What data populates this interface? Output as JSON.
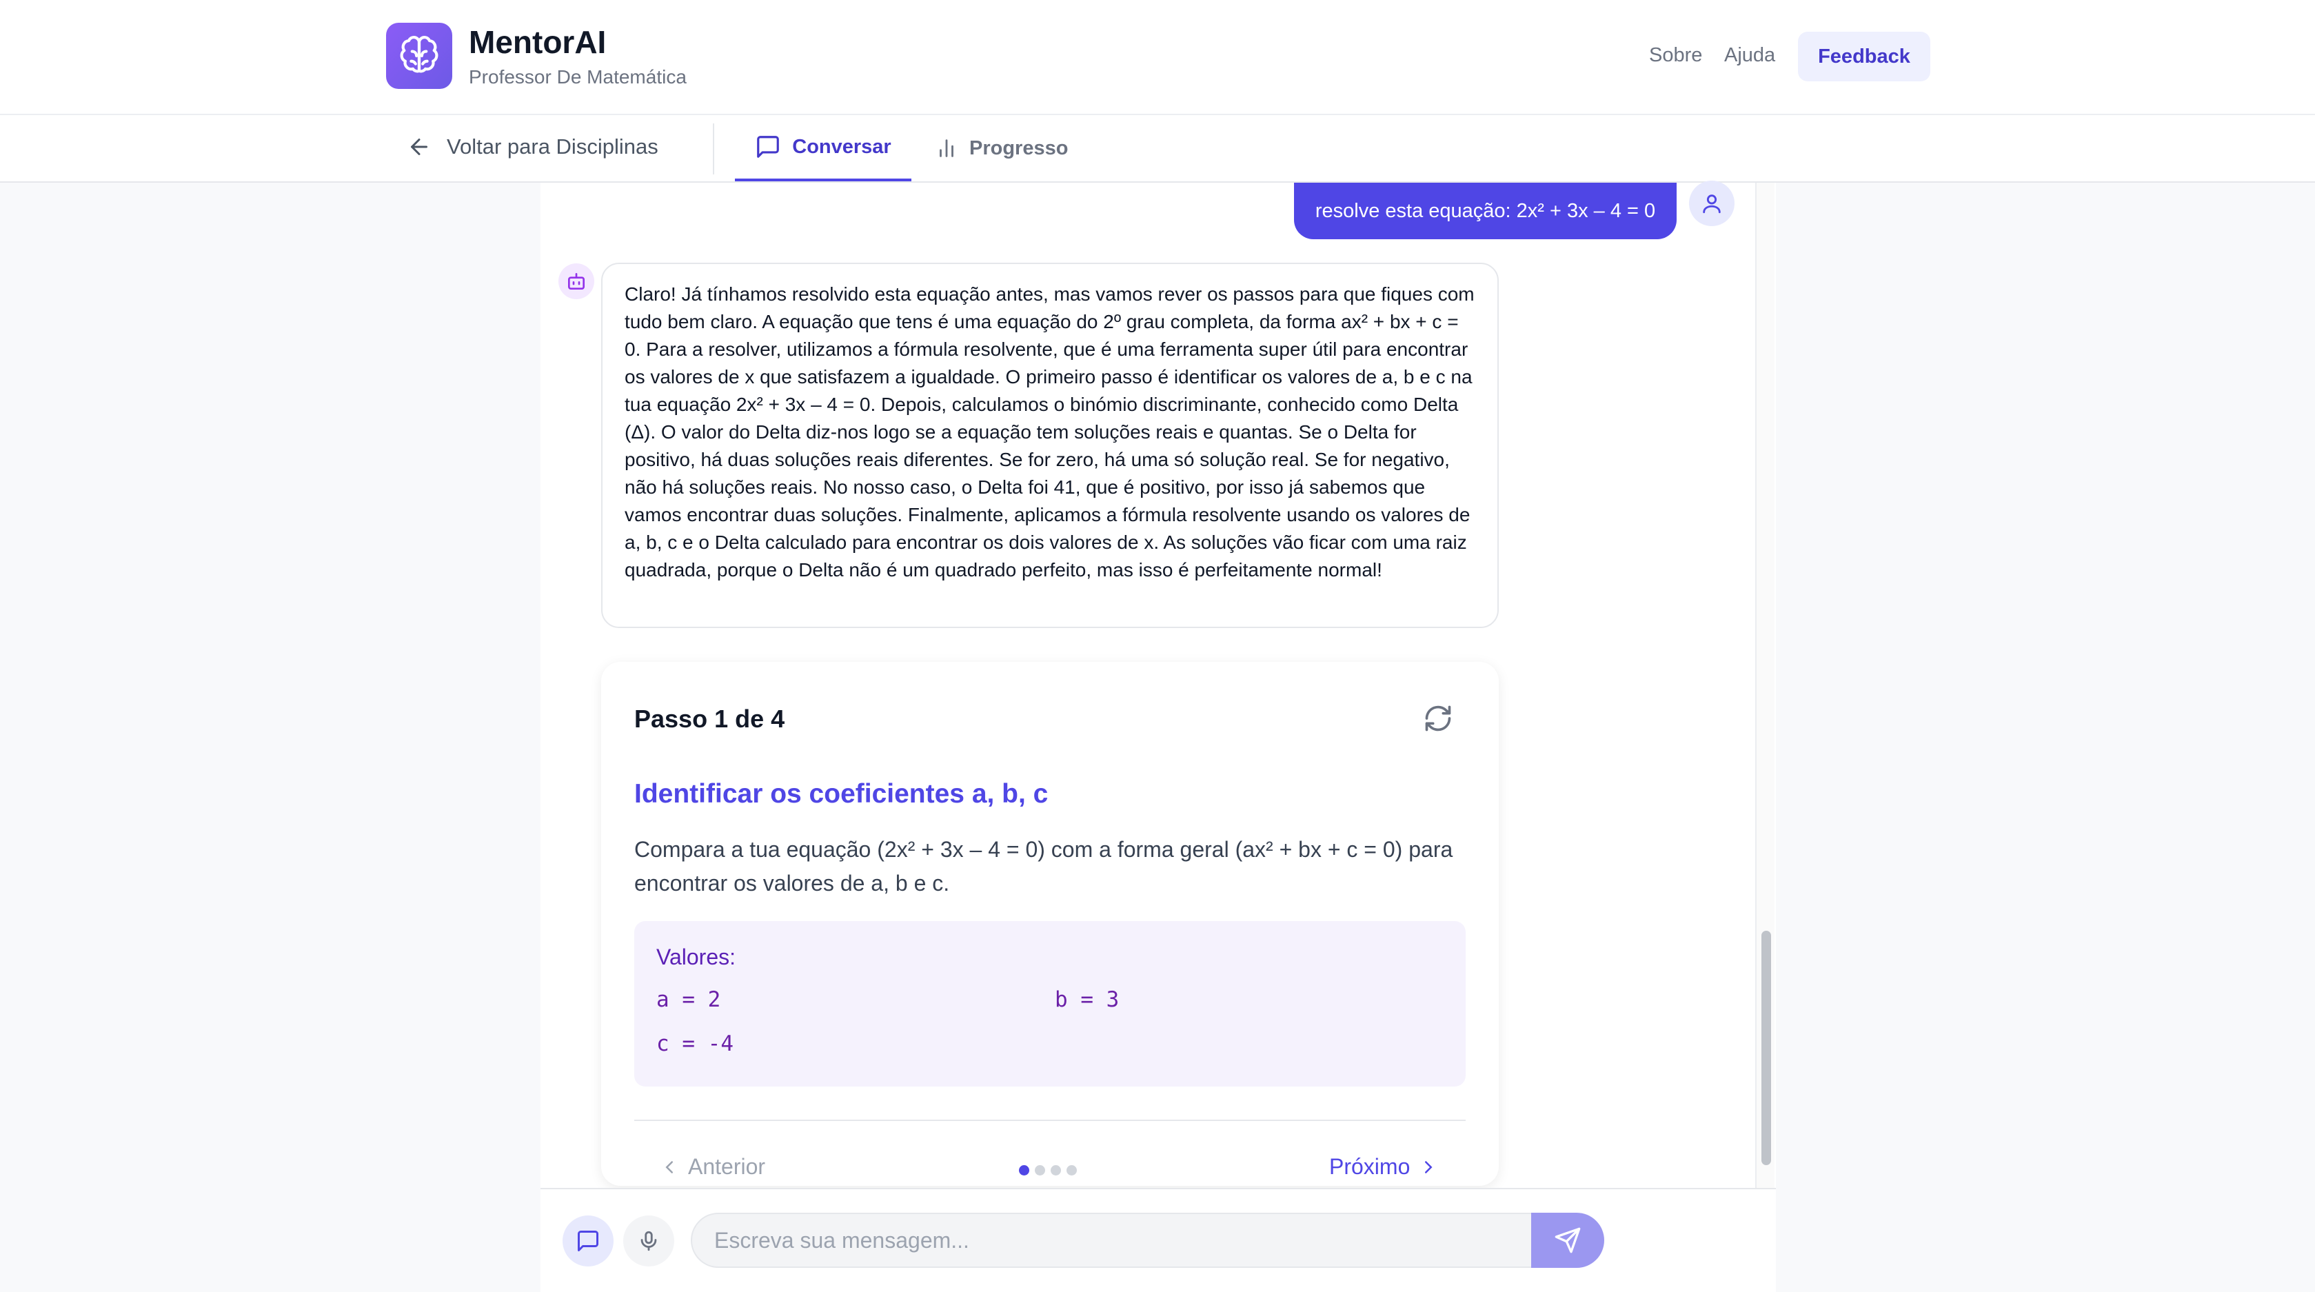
{
  "header": {
    "app_name": "MentorAI",
    "subtitle": "Professor De Matemática",
    "links": [
      "Sobre",
      "Ajuda"
    ],
    "feedback_label": "Feedback"
  },
  "nav": {
    "back_label": "Voltar para Disciplinas",
    "tabs": [
      {
        "label": "Conversar",
        "active": true,
        "icon": "chat-icon"
      },
      {
        "label": "Progresso",
        "active": false,
        "icon": "bar-chart-icon"
      }
    ]
  },
  "chat": {
    "user_message": "resolve esta equação: 2x² + 3x – 4 = 0",
    "bot_message": "Claro! Já tínhamos resolvido esta equação antes, mas vamos rever os passos para que fiques com tudo bem claro. A equação que tens é uma equação do 2º grau completa, da forma ax² + bx + c = 0. Para a resolver, utilizamos a fórmula resolvente, que é uma ferramenta super útil para encontrar os valores de x que satisfazem a igualdade. O primeiro passo é identificar os valores de a, b e c na tua equação 2x² + 3x – 4 = 0. Depois, calculamos o binómio discriminante, conhecido como Delta (Δ). O valor do Delta diz-nos logo se a equação tem soluções reais e quantas. Se o Delta for positivo, há duas soluções reais diferentes. Se for zero, há uma só solução real. Se for negativo, não há soluções reais. No nosso caso, o Delta foi 41, que é positivo, por isso já sabemos que vamos encontrar duas soluções. Finalmente, aplicamos a fórmula resolvente usando os valores de a, b, c e o Delta calculado para encontrar os dois valores de x. As soluções vão ficar com uma raiz quadrada, porque o Delta não é um quadrado perfeito, mas isso é perfeitamente normal!"
  },
  "step_card": {
    "title": "Passo 1 de 4",
    "heading": "Identificar os coeficientes a, b, c",
    "description": "Compara a tua equação (2x² + 3x – 4 = 0) com a forma geral (ax² + bx + c = 0) para encontrar os valores de a, b e c.",
    "values_label": "Valores:",
    "values": [
      "a = 2",
      "b = 3",
      "c = -4"
    ],
    "prev_label": "Anterior",
    "next_label": "Próximo",
    "current_step": 1,
    "total_steps": 4
  },
  "input": {
    "placeholder": "Escreva sua mensagem..."
  },
  "colors": {
    "accent": "#4f46e5",
    "user_bubble": "#4f46e5",
    "values_bg": "#f5f2fd"
  }
}
